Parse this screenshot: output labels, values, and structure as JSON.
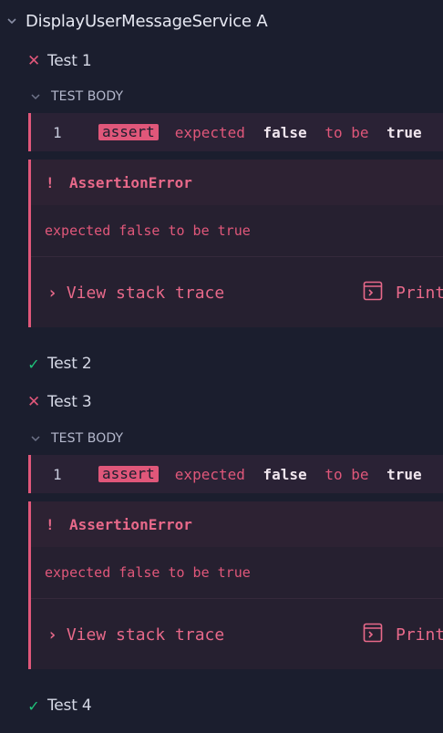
{
  "suite": {
    "title": "DisplayUserMessageService A"
  },
  "tests": [
    {
      "title": "Test 1",
      "status": "failed",
      "body_label": "TEST BODY",
      "command": {
        "index": "1",
        "name": "assert",
        "msg_pre": "expected",
        "msg_val1": "false",
        "msg_mid": "to be",
        "msg_val2": "true"
      },
      "error": {
        "bang": "!",
        "type": "AssertionError",
        "message": "expected false to be true",
        "stack_label": "View stack trace",
        "print_label": "Print to console"
      }
    },
    {
      "title": "Test 2",
      "status": "passed"
    },
    {
      "title": "Test 3",
      "status": "failed",
      "body_label": "TEST BODY",
      "command": {
        "index": "1",
        "name": "assert",
        "msg_pre": "expected",
        "msg_val1": "false",
        "msg_mid": "to be",
        "msg_val2": "true"
      },
      "error": {
        "bang": "!",
        "type": "AssertionError",
        "message": "expected false to be true",
        "stack_label": "View stack trace",
        "print_label": "Print to console"
      }
    },
    {
      "title": "Test 4",
      "status": "passed"
    }
  ],
  "icons": {
    "fail": "✕",
    "pass": "✓",
    "stack_chevron": "›"
  },
  "colors": {
    "background": "#1b1e2e",
    "fail_accent": "#e0577a",
    "pass_accent": "#1fc37a"
  }
}
